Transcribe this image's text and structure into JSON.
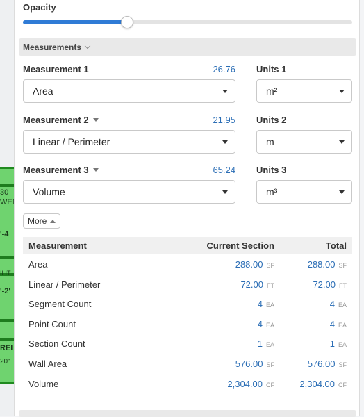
{
  "opacity": {
    "label": "Opacity",
    "value_fraction": 0.315
  },
  "measurements": {
    "header": "Measurements",
    "rows": [
      {
        "label": "Measurement 1",
        "value": "26.76",
        "select": "Area",
        "units_label": "Units 1",
        "units": "m²",
        "has_caret": false
      },
      {
        "label": "Measurement 2",
        "value": "21.95",
        "select": "Linear / Perimeter",
        "units_label": "Units 2",
        "units": "m",
        "has_caret": true
      },
      {
        "label": "Measurement 3",
        "value": "65.24",
        "select": "Volume",
        "units_label": "Units 3",
        "units": "m³",
        "has_caret": true
      }
    ],
    "more_label": "More"
  },
  "table": {
    "headers": {
      "measurement": "Measurement",
      "current": "Current Section",
      "total": "Total"
    },
    "rows": [
      {
        "name": "Area",
        "current": "288.00",
        "current_unit": "SF",
        "total": "288.00",
        "total_unit": "SF"
      },
      {
        "name": "Linear / Perimeter",
        "current": "72.00",
        "current_unit": "FT",
        "total": "72.00",
        "total_unit": "FT"
      },
      {
        "name": "Segment Count",
        "current": "4",
        "current_unit": "EA",
        "total": "4",
        "total_unit": "EA"
      },
      {
        "name": "Point Count",
        "current": "4",
        "current_unit": "EA",
        "total": "4",
        "total_unit": "EA"
      },
      {
        "name": "Section Count",
        "current": "1",
        "current_unit": "EA",
        "total": "1",
        "total_unit": "EA"
      },
      {
        "name": "Wall Area",
        "current": "576.00",
        "current_unit": "SF",
        "total": "576.00",
        "total_unit": "SF"
      },
      {
        "name": "Volume",
        "current": "2,304.00",
        "current_unit": "CF",
        "total": "2,304.00",
        "total_unit": "CF"
      }
    ]
  },
  "background": {
    "fragments": [
      "30",
      "WEF",
      "'-4",
      "ILIT",
      "'-2'",
      "REI",
      "20\""
    ]
  },
  "colors": {
    "accent": "#2f7bd6",
    "value_text": "#2a6db5",
    "plan_green": "#6fd36f"
  }
}
